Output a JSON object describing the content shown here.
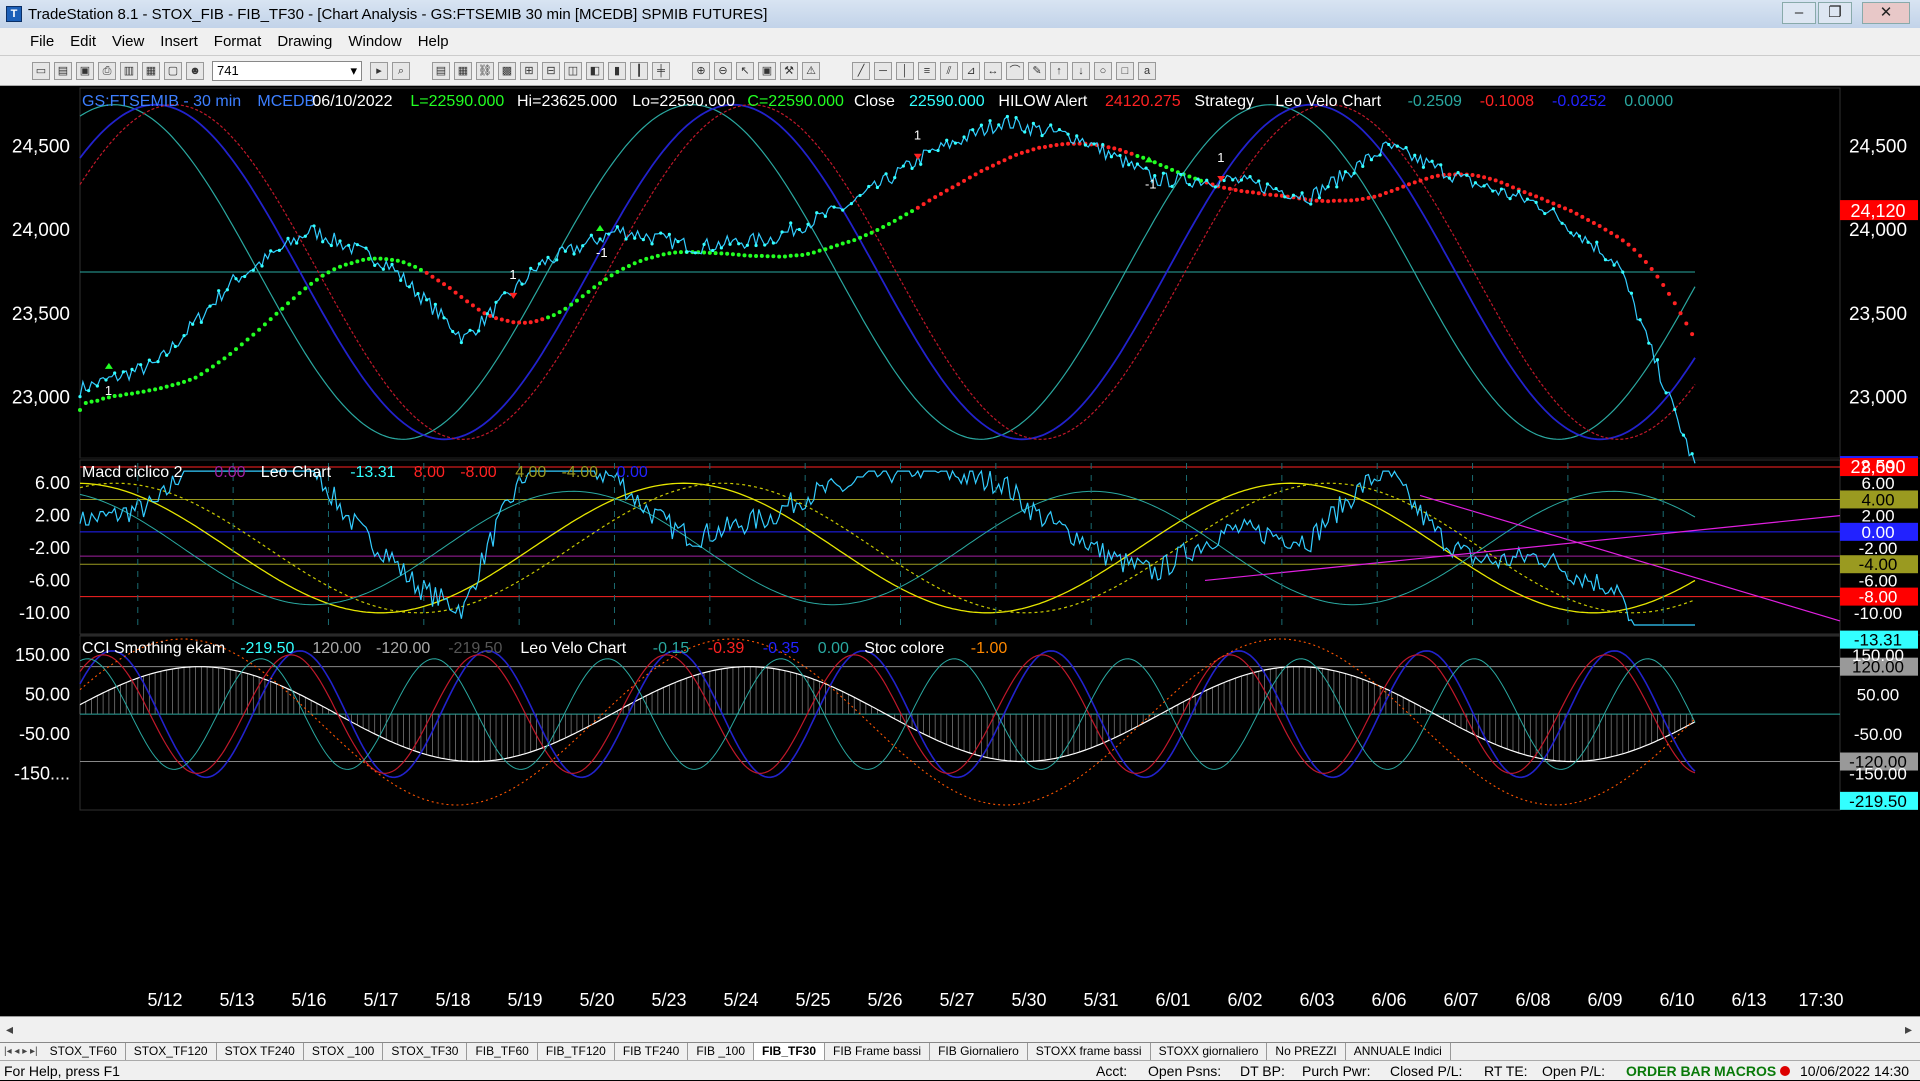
{
  "window": {
    "title": "TradeStation 8.1 - STOX_FIB - FIB_TF30 - [Chart Analysis - GS:FTSEMIB  30 min  [MCEDB] SPMIB FUTURES]",
    "minimize": "–",
    "restore": "❐",
    "close": "✕"
  },
  "menu": [
    "File",
    "Edit",
    "View",
    "Insert",
    "Format",
    "Drawing",
    "Window",
    "Help"
  ],
  "toolbar": {
    "symbol_value": "741"
  },
  "price_panel": {
    "header": [
      {
        "text": "GS:FTSEMIB - 30 min",
        "color": "#3d7fff"
      },
      {
        "text": "MCEDB",
        "color": "#3d7fff"
      },
      {
        "text": "06/10/2022",
        "color": "#ffffff"
      },
      {
        "text": "L=22590.000",
        "color": "#22ff22"
      },
      {
        "text": "Hi=23625.000",
        "color": "#ffffff"
      },
      {
        "text": "Lo=22590.000",
        "color": "#ffffff"
      },
      {
        "text": "C=22590.000",
        "color": "#22ff22"
      },
      {
        "text": "Close",
        "color": "#ffffff"
      },
      {
        "text": "22590.000",
        "color": "#33ffff"
      },
      {
        "text": "HILOW Alert",
        "color": "#ffffff"
      },
      {
        "text": "24120.275",
        "color": "#ff2222"
      },
      {
        "text": "Strategy",
        "color": "#ffffff"
      },
      {
        "text": "Leo Velo Chart",
        "color": "#ffffff"
      },
      {
        "text": "-0.2509",
        "color": "#2aa8a0"
      },
      {
        "text": "-0.1008",
        "color": "#ff2222"
      },
      {
        "text": "-0.0252",
        "color": "#2222ff"
      },
      {
        "text": "0.0000",
        "color": "#2aa8a0"
      }
    ],
    "y_ticks": [
      "24,500",
      "24,000",
      "23,500",
      "23,000"
    ],
    "last_price": "22,590",
    "hilow_label": "24,120",
    "markers": [
      "1",
      "1",
      "-1",
      "1",
      "-1",
      "1",
      "-1"
    ]
  },
  "macd_panel": {
    "header": [
      {
        "text": "Macd ciclico 2",
        "color": "#ffffff"
      },
      {
        "text": "0.00",
        "color": "#a020a0"
      },
      {
        "text": "Leo Chart",
        "color": "#ffffff"
      },
      {
        "text": "-13.31",
        "color": "#33ffff"
      },
      {
        "text": "8.00",
        "color": "#ff2222"
      },
      {
        "text": "-8.00",
        "color": "#ff2222"
      },
      {
        "text": "4.00",
        "color": "#9a9a20"
      },
      {
        "text": "-4.00",
        "color": "#9a9a20"
      },
      {
        "text": "0.00",
        "color": "#2222ff"
      }
    ],
    "y_ticks": [
      "6.00",
      "2.00",
      "-2.00",
      "-6.00",
      "-10.00"
    ],
    "badges": [
      {
        "text": "8.00",
        "bg": "#ff0000",
        "fg": "#ffffff"
      },
      {
        "text": "6.00",
        "bg": "#000000",
        "fg": "#ffffff"
      },
      {
        "text": "4.00",
        "bg": "#9a9a20",
        "fg": "#000000"
      },
      {
        "text": "2.00",
        "bg": "#000000",
        "fg": "#ffffff"
      },
      {
        "text": "0.00",
        "bg": "#2222ff",
        "fg": "#ffffff"
      },
      {
        "text": "-2.00",
        "bg": "#000000",
        "fg": "#ffffff"
      },
      {
        "text": "-4.00",
        "bg": "#9a9a20",
        "fg": "#000000"
      },
      {
        "text": "-6.00",
        "bg": "#000000",
        "fg": "#ffffff"
      },
      {
        "text": "-8.00",
        "bg": "#ff0000",
        "fg": "#ffffff"
      },
      {
        "text": "-10.00",
        "bg": "#000000",
        "fg": "#ffffff"
      },
      {
        "text": "-13.31",
        "bg": "#33ffff",
        "fg": "#000000"
      }
    ]
  },
  "cci_panel": {
    "header": [
      {
        "text": "CCI Smothing ekam",
        "color": "#ffffff"
      },
      {
        "text": "-219.50",
        "color": "#33ffff"
      },
      {
        "text": "120.00",
        "color": "#aaaaaa"
      },
      {
        "text": "-120.00",
        "color": "#aaaaaa"
      },
      {
        "text": "-219.50",
        "color": "#555555"
      },
      {
        "text": "Leo Velo Chart",
        "color": "#ffffff"
      },
      {
        "text": "-0.15",
        "color": "#2aa8a0"
      },
      {
        "text": "-0.39",
        "color": "#ff2222"
      },
      {
        "text": "-0.35",
        "color": "#2222ff"
      },
      {
        "text": "0.00",
        "color": "#2aa8a0"
      },
      {
        "text": "Stoc colore",
        "color": "#ffffff"
      },
      {
        "text": "-1.00",
        "color": "#ff8800"
      }
    ],
    "y_ticks": [
      "150.00",
      "50.00",
      "-50.00",
      "-150...."
    ],
    "badges": [
      {
        "text": "150.00",
        "bg": "#000000",
        "fg": "#ffffff"
      },
      {
        "text": "120.00",
        "bg": "#999999",
        "fg": "#000000"
      },
      {
        "text": "50.00",
        "bg": "#000000",
        "fg": "#ffffff"
      },
      {
        "text": "-50.00",
        "bg": "#000000",
        "fg": "#ffffff"
      },
      {
        "text": "-120.00",
        "bg": "#999999",
        "fg": "#000000"
      },
      {
        "text": "-150.00",
        "bg": "#000000",
        "fg": "#ffffff"
      },
      {
        "text": "-219.50",
        "bg": "#33ffff",
        "fg": "#000000"
      }
    ]
  },
  "x_axis": [
    "5/12",
    "5/13",
    "5/16",
    "5/17",
    "5/18",
    "5/19",
    "5/20",
    "5/23",
    "5/24",
    "5/25",
    "5/26",
    "5/27",
    "5/30",
    "5/31",
    "6/01",
    "6/02",
    "6/03",
    "6/06",
    "6/07",
    "6/08",
    "6/09",
    "6/10",
    "6/13",
    "17:30"
  ],
  "tabs": [
    "STOX_TF60",
    "STOX_TF120",
    "STOX TF240",
    "STOX _100",
    "STOX_TF30",
    "FIB_TF60",
    "FIB_TF120",
    "FIB TF240",
    "FIB _100",
    "FIB_TF30",
    "FIB Frame bassi",
    "FIB Giornaliero",
    "STOXX frame bassi",
    "STOXX giornaliero",
    "No PREZZI",
    "ANNUALE Indici"
  ],
  "active_tab": "FIB_TF30",
  "status": {
    "help": "For Help, press F1",
    "acct": "Acct:",
    "open_psns": "Open Psns:",
    "dt_bp": "DT BP:",
    "purch_pwr": "Purch Pwr:",
    "closed_pl": "Closed P/L:",
    "rt_te": "RT TE:",
    "open_pl": "Open P/L:",
    "order_bar": "ORDER BAR",
    "macros": "MACROS",
    "datetime": "10/06/2022 14:30"
  },
  "chart_data": [
    {
      "type": "line",
      "title": "GS:FTSEMIB - 30 min",
      "x": [
        "5/12",
        "5/13",
        "5/16",
        "5/17",
        "5/18",
        "5/19",
        "5/20",
        "5/23",
        "5/24",
        "5/25",
        "5/26",
        "5/27",
        "5/30",
        "5/31",
        "6/01",
        "6/02",
        "6/03",
        "6/06",
        "6/07",
        "6/08",
        "6/09",
        "6/10"
      ],
      "series": [
        {
          "name": "Close",
          "values": [
            23050,
            23200,
            23700,
            24000,
            23800,
            23350,
            23800,
            24000,
            23900,
            23950,
            24150,
            24450,
            24650,
            24550,
            24300,
            24300,
            24200,
            24500,
            24300,
            24150,
            23800,
            22590
          ]
        }
      ],
      "ylim": [
        22650,
        24850
      ]
    },
    {
      "type": "line",
      "title": "Macd ciclico 2",
      "ylim": [
        -12,
        8.5
      ]
    },
    {
      "type": "line",
      "title": "CCI Smothing ekam",
      "ylim": [
        -230,
        190
      ]
    }
  ],
  "colors": {
    "accent_cyan": "#33ffff",
    "up_green": "#22ff22",
    "down_red": "#ff2222",
    "line_blue": "#2222cc",
    "line_teal": "#2aa8a0",
    "line_darkred": "#c0182a"
  }
}
